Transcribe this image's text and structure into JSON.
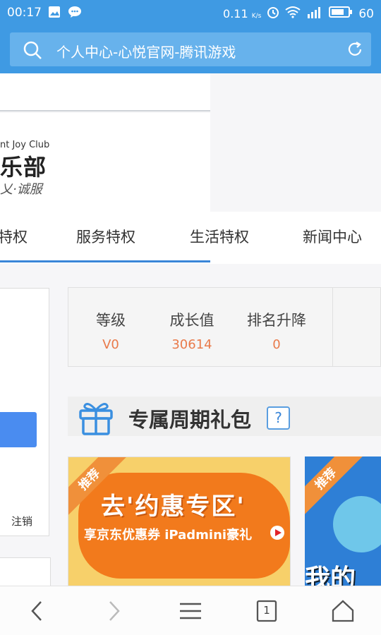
{
  "status_bar": {
    "time": "00:17",
    "speed": "0.11",
    "speed_unit": "K/s",
    "battery": "60"
  },
  "url_bar": {
    "title": "个人中心-心悦官网-腾讯游戏"
  },
  "logo": {
    "english": "nt Joy Club",
    "chinese": "乐部",
    "slogan": "乂·诚服"
  },
  "nav": {
    "tabs": [
      {
        "label": "特权"
      },
      {
        "label": "服务特权"
      },
      {
        "label": "生活特权"
      },
      {
        "label": "新闻中心"
      }
    ]
  },
  "left_panel": {
    "logout": "注销"
  },
  "stats": {
    "items": [
      {
        "label": "等级",
        "value": "V0"
      },
      {
        "label": "成长值",
        "value": "30614"
      },
      {
        "label": "排名升降",
        "value": "0"
      }
    ]
  },
  "gift": {
    "title": "专属周期礼包",
    "help": "?"
  },
  "banners": [
    {
      "ribbon": "推荐",
      "title": "去'约惠专区'",
      "subtitle": "享京东优惠券 iPadmini豪礼"
    },
    {
      "ribbon": "推荐",
      "title": "我的"
    }
  ],
  "bottom_bar": {
    "tab_count": "1"
  }
}
